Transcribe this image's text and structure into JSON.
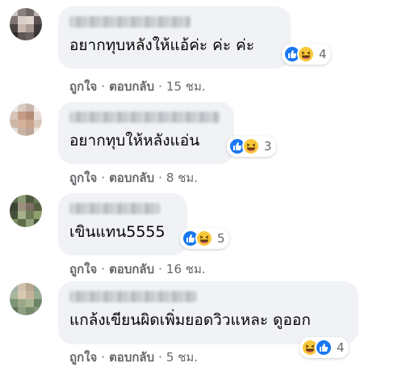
{
  "colors": {
    "bubble": "#f0f2f5",
    "meta": "#65676b",
    "like": "#1877f2",
    "haha": "#f7c83b"
  },
  "comments": [
    {
      "text": "อยากทุบหลังให้แอ้ค่ะ ค่ะ ค่ะ",
      "reaction_count": "4",
      "reactions": [
        "like-icon",
        "haha-icon"
      ],
      "like_label": "ถูกใจ",
      "reply_label": "ตอบกลับ",
      "time": "15 ชม."
    },
    {
      "text": "อยากทุบให้หลังแอ่น",
      "reaction_count": "3",
      "reactions": [
        "like-icon",
        "haha-icon"
      ],
      "like_label": "ถูกใจ",
      "reply_label": "ตอบกลับ",
      "time": "8 ชม."
    },
    {
      "text": "เขินแทน5555",
      "reaction_count": "5",
      "reactions": [
        "like-icon",
        "haha-icon"
      ],
      "like_label": "ถูกใจ",
      "reply_label": "ตอบกลับ",
      "time": "16 ชม."
    },
    {
      "text": "แกล้งเขียนผิดเพิ่มยอดวิวแหละ ดูออก",
      "reaction_count": "4",
      "reactions": [
        "haha-icon",
        "like-icon"
      ],
      "like_label": "ถูกใจ",
      "reply_label": "ตอบกลับ",
      "time": "5 ชม."
    }
  ],
  "separator": "·"
}
